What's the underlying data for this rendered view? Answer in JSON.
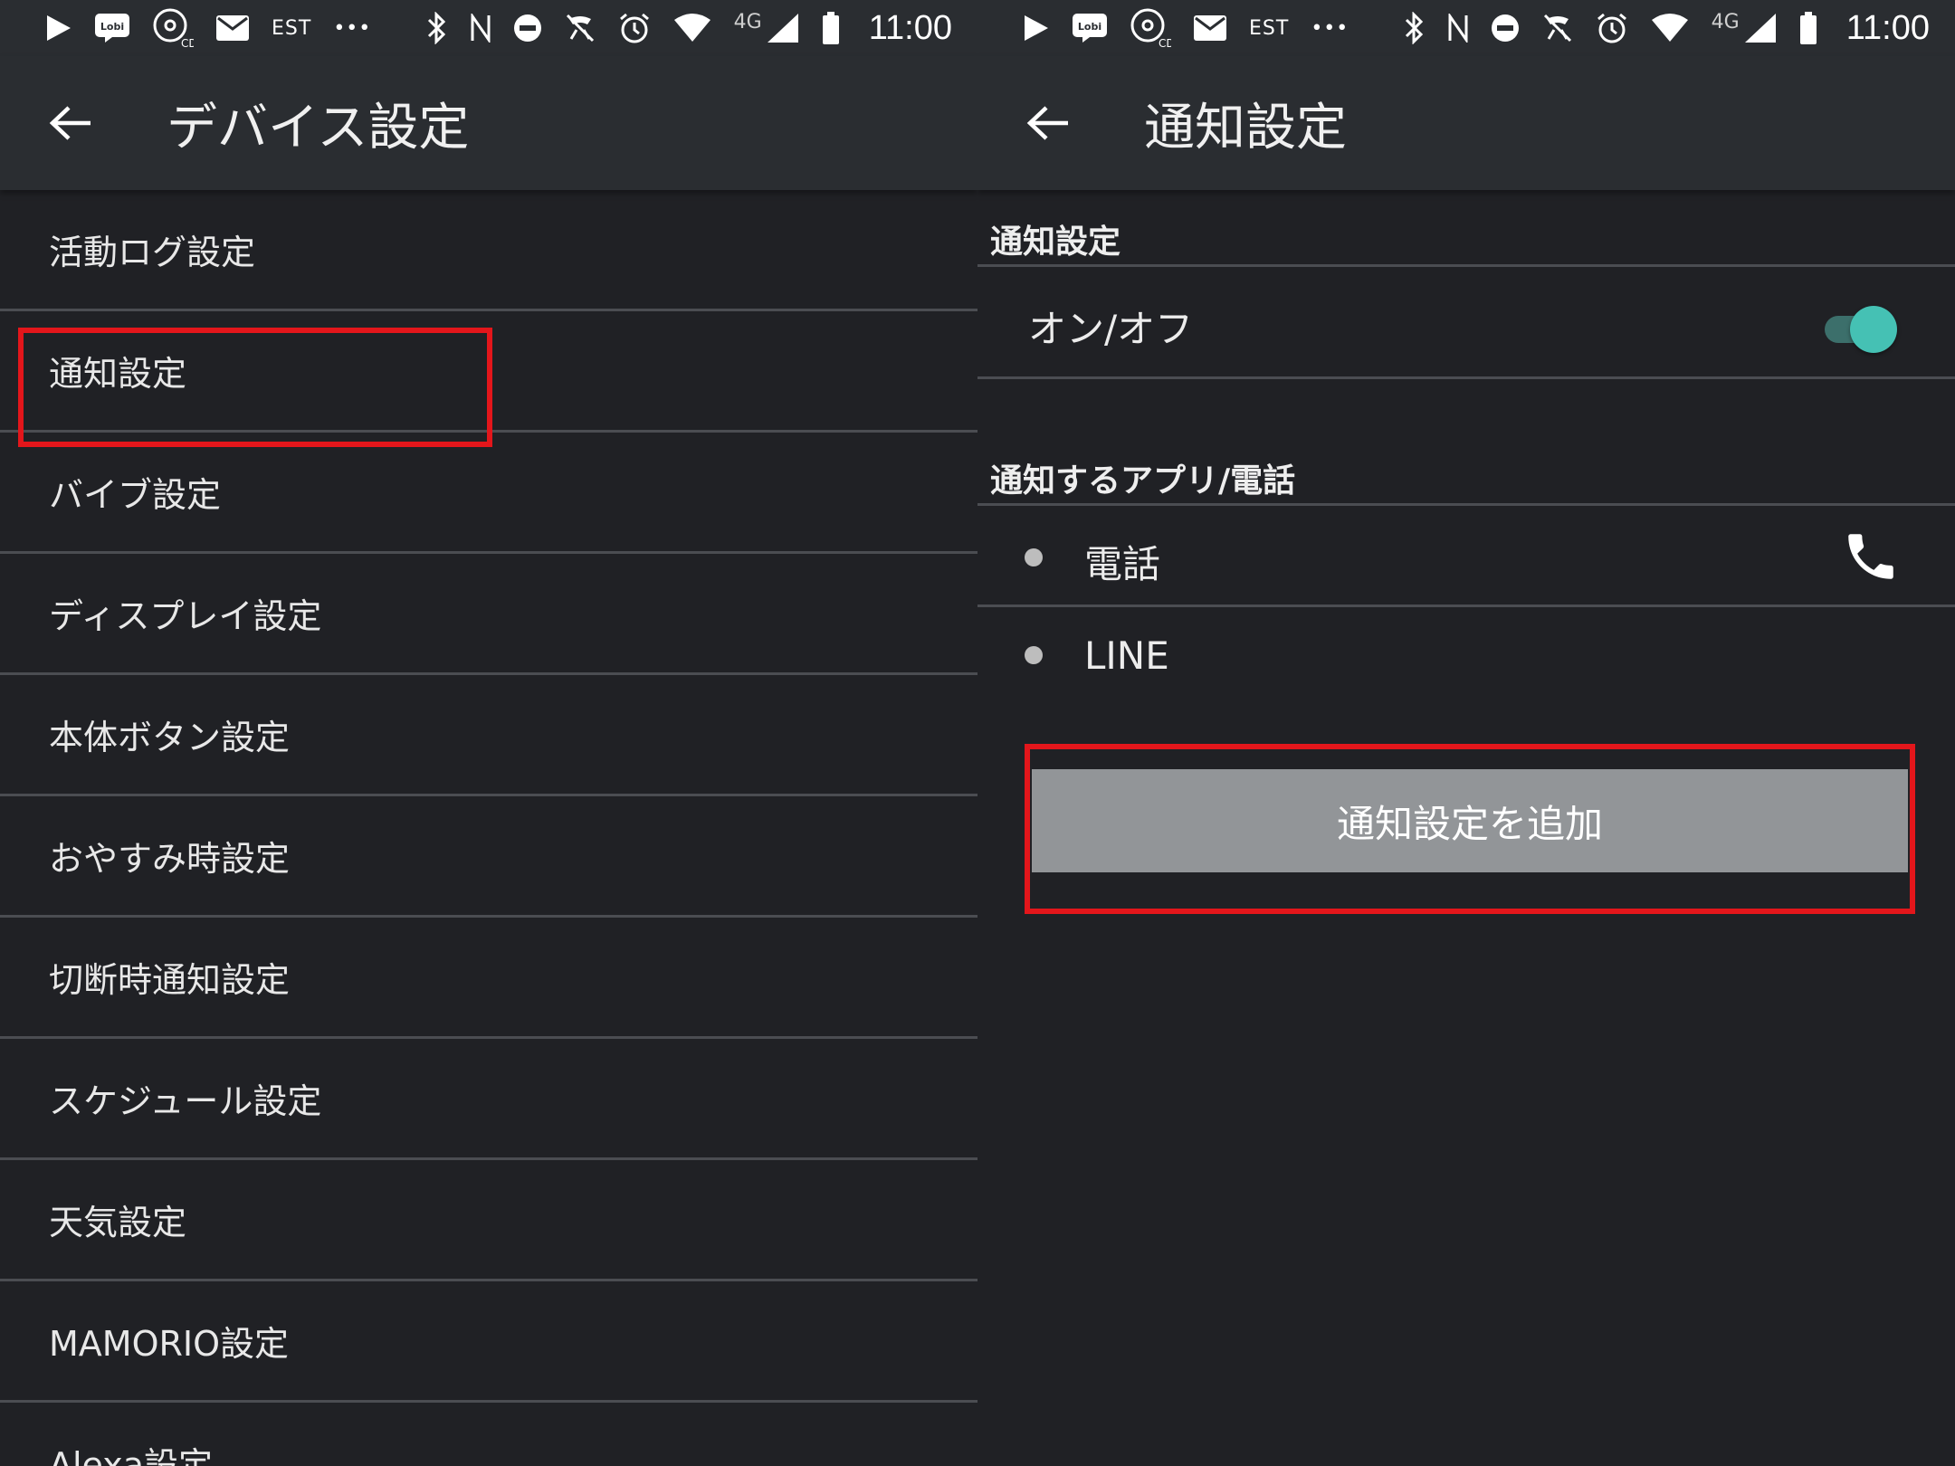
{
  "status_bar": {
    "time": "11:00",
    "network": "4G",
    "carrier_label": "EST",
    "lobi_label": "Lobi",
    "cd_label": "CD",
    "overflow": "•••"
  },
  "left_screen": {
    "title": "デバイス設定",
    "items": [
      {
        "label": "活動ログ設定"
      },
      {
        "label": "通知設定",
        "highlighted": true
      },
      {
        "label": "バイブ設定"
      },
      {
        "label": "ディスプレイ設定"
      },
      {
        "label": "本体ボタン設定"
      },
      {
        "label": "おやすみ時設定"
      },
      {
        "label": "切断時通知設定"
      },
      {
        "label": "スケジュール設定"
      },
      {
        "label": "天気設定"
      },
      {
        "label": "MAMORIO設定"
      },
      {
        "label": "Alexa設定"
      }
    ]
  },
  "right_screen": {
    "title": "通知設定",
    "section_notification": "通知設定",
    "toggle_label": "オン/オフ",
    "toggle_on": true,
    "section_apps": "通知するアプリ/電話",
    "apps": [
      {
        "label": "電話",
        "icon": "phone-icon"
      },
      {
        "label": "LINE"
      }
    ],
    "add_button": "通知設定を追加"
  },
  "colors": {
    "background": "#202125",
    "appbar": "#2a2d31",
    "highlight": "#e3161b",
    "toggle_thumb": "#45c1b4",
    "button": "#929598"
  }
}
